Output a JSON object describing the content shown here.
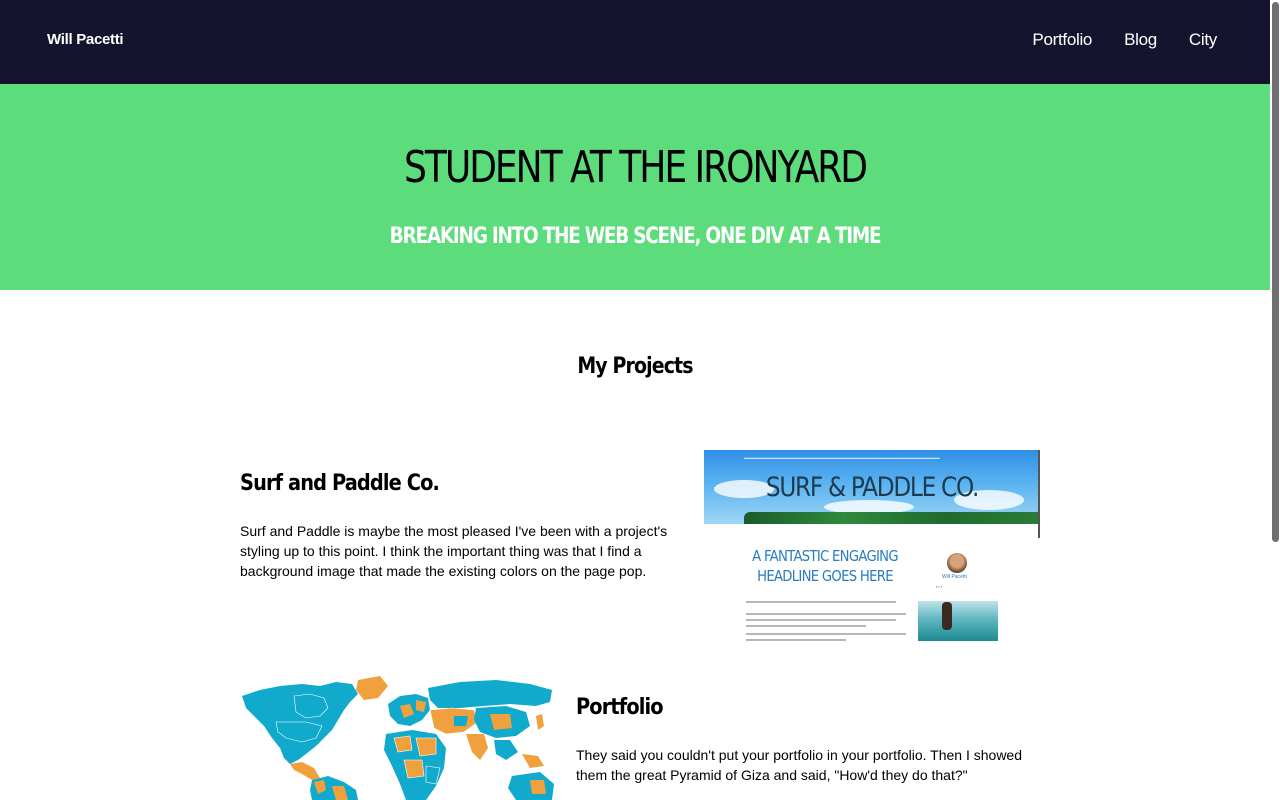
{
  "nav": {
    "brand": "Will Pacetti",
    "links": [
      "Portfolio",
      "Blog",
      "City"
    ]
  },
  "hero": {
    "title": "STUDENT AT THE IRONYARD",
    "subtitle": "BREAKING INTO THE WEB SCENE, ONE DIV AT A TIME"
  },
  "projects_section": {
    "title": "My Projects",
    "items": [
      {
        "title": "Surf and Paddle Co.",
        "description": "Surf and Paddle is maybe the most pleased I've been with a project's styling up to this point. I think the important thing was that I find a background image that made the existing colors on the page pop.",
        "thumbnail": {
          "site_title": "SURF & PADDLE CO.",
          "headline": "A FANTASTIC ENGAGING HEADLINE GOES HERE",
          "author": "Will Pacetti"
        }
      },
      {
        "title": "Portfolio",
        "description": "They said you couldn't put your portfolio in your portfolio. Then I showed them the great Pyramid of Giza and said, \"How'd they do that?\""
      }
    ]
  },
  "colors": {
    "navbar": "#15142f",
    "hero": "#5ddc7c",
    "map_blue": "#12aacc",
    "map_orange": "#f0a13e"
  }
}
